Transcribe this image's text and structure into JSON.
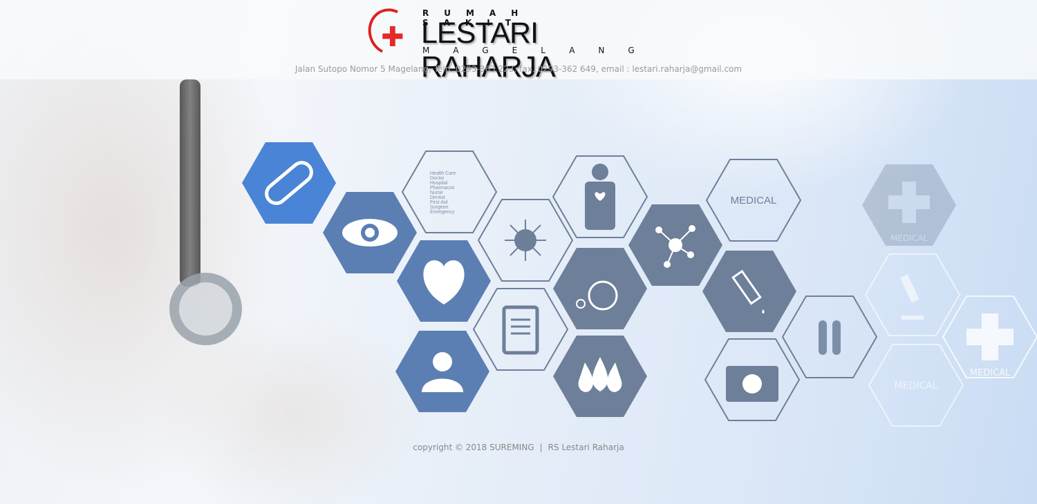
{
  "header": {
    "logo_top": "RUMAH SAKIT",
    "logo_name": "LESTARI RAHARJA",
    "logo_city": "MAGELANG",
    "address": "Jalan Sutopo Nomor 5 Magelang, Telp. 0293-363 223, fax. 0293-362 649, email : lestari.raharja@gmail.com"
  },
  "hexagons": {
    "list": [
      "Health Care",
      "Doctor",
      "Hospital",
      "Pharmacist",
      "Nurse",
      "Dentist",
      "First Aid",
      "Surgeon",
      "Emergency"
    ],
    "medical_1": "MEDICAL",
    "medical_2": "MEDICAL",
    "medical_3": "MEDICAL",
    "medical_4": "MEDICAL"
  },
  "colors": {
    "accent_red": "#e52a2a",
    "hex_blue": "#5b7fb3",
    "hex_gray": "#6d7f99"
  },
  "footer": {
    "copyright": "copyright © 2018 SUREMING",
    "separator": "|",
    "org": "RS Lestari Raharja"
  }
}
